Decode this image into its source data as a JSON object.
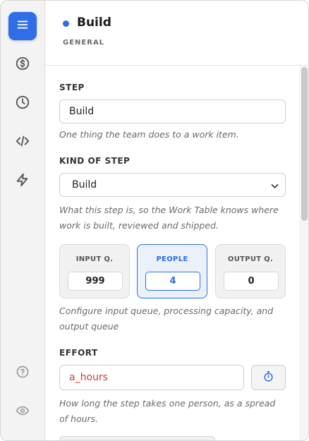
{
  "header": {
    "title": "Build",
    "subtitle": "GENERAL",
    "dot_color": "#2f6ee6"
  },
  "rail": {
    "items": [
      {
        "icon": "menu-icon",
        "active": true
      },
      {
        "icon": "dollar-icon",
        "active": false
      },
      {
        "icon": "clock-icon",
        "active": false
      },
      {
        "icon": "code-icon",
        "active": false
      },
      {
        "icon": "bolt-icon",
        "active": false
      },
      {
        "icon": "help-icon",
        "active": false
      },
      {
        "icon": "eye-icon",
        "active": false
      }
    ]
  },
  "form": {
    "step": {
      "label": "STEP",
      "value": "Build",
      "help": "One thing the team does to a work item."
    },
    "kind": {
      "label": "KIND OF STEP",
      "value": "Build",
      "help": "What this step is, so the Work Table knows where work is built, reviewed and shipped."
    },
    "queues": {
      "input": {
        "label": "INPUT Q.",
        "value": "999"
      },
      "people": {
        "label": "PEOPLE",
        "value": "4"
      },
      "output": {
        "label": "OUTPUT Q.",
        "value": "0"
      },
      "help": "Configure input queue, processing capacity, and output queue"
    },
    "effort": {
      "label": "EFFORT",
      "value": "a_hours",
      "help": "How long the step takes one person, as a spread of hours."
    }
  },
  "colors": {
    "accent": "#2f6ee6",
    "error_text": "#d33a3a"
  }
}
